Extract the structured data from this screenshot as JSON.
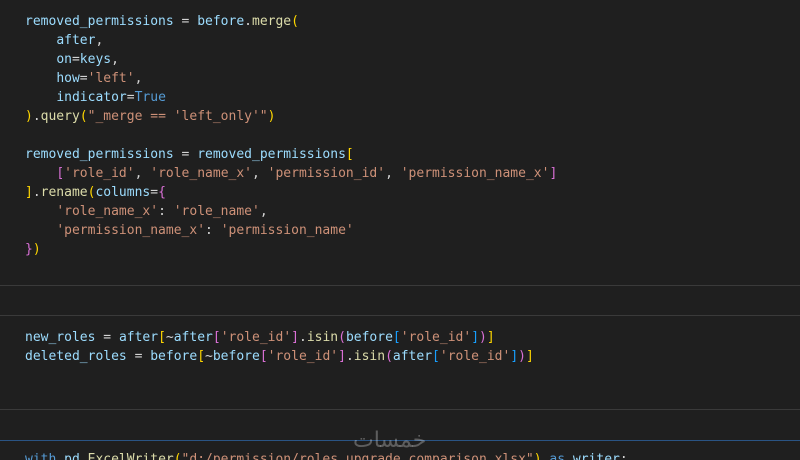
{
  "cell1": {
    "lines": [
      [
        [
          "v",
          "removed_permissions"
        ],
        [
          "o",
          " = "
        ],
        [
          "v",
          "before"
        ],
        [
          "o",
          "."
        ],
        [
          "f",
          "merge"
        ],
        [
          "b1",
          "("
        ]
      ],
      [
        [
          "o",
          "    "
        ],
        [
          "v",
          "after"
        ],
        [
          "o",
          ","
        ]
      ],
      [
        [
          "o",
          "    "
        ],
        [
          "v",
          "on"
        ],
        [
          "o",
          "="
        ],
        [
          "v",
          "keys"
        ],
        [
          "o",
          ","
        ]
      ],
      [
        [
          "o",
          "    "
        ],
        [
          "v",
          "how"
        ],
        [
          "o",
          "="
        ],
        [
          "s",
          "'left'"
        ],
        [
          "o",
          ","
        ]
      ],
      [
        [
          "o",
          "    "
        ],
        [
          "v",
          "indicator"
        ],
        [
          "o",
          "="
        ],
        [
          "k",
          "True"
        ]
      ],
      [
        [
          "b1",
          ")"
        ],
        [
          "o",
          "."
        ],
        [
          "f",
          "query"
        ],
        [
          "b1",
          "("
        ],
        [
          "s",
          "\"_merge == 'left_only'\""
        ],
        [
          "b1",
          ")"
        ]
      ],
      [
        [
          "o",
          ""
        ]
      ],
      [
        [
          "v",
          "removed_permissions"
        ],
        [
          "o",
          " = "
        ],
        [
          "v",
          "removed_permissions"
        ],
        [
          "b1",
          "["
        ]
      ],
      [
        [
          "o",
          "    "
        ],
        [
          "b2",
          "["
        ],
        [
          "s",
          "'role_id'"
        ],
        [
          "o",
          ", "
        ],
        [
          "s",
          "'role_name_x'"
        ],
        [
          "o",
          ", "
        ],
        [
          "s",
          "'permission_id'"
        ],
        [
          "o",
          ", "
        ],
        [
          "s",
          "'permission_name_x'"
        ],
        [
          "b2",
          "]"
        ]
      ],
      [
        [
          "b1",
          "]"
        ],
        [
          "o",
          "."
        ],
        [
          "f",
          "rename"
        ],
        [
          "b1",
          "("
        ],
        [
          "v",
          "columns"
        ],
        [
          "o",
          "="
        ],
        [
          "b2",
          "{"
        ]
      ],
      [
        [
          "o",
          "    "
        ],
        [
          "s",
          "'role_name_x'"
        ],
        [
          "o",
          ": "
        ],
        [
          "s",
          "'role_name'"
        ],
        [
          "o",
          ","
        ]
      ],
      [
        [
          "o",
          "    "
        ],
        [
          "s",
          "'permission_name_x'"
        ],
        [
          "o",
          ": "
        ],
        [
          "s",
          "'permission_name'"
        ]
      ],
      [
        [
          "b2",
          "}"
        ],
        [
          "b1",
          ")"
        ]
      ]
    ]
  },
  "cell2": {
    "lines": [
      [
        [
          "v",
          "new_roles"
        ],
        [
          "o",
          " = "
        ],
        [
          "v",
          "after"
        ],
        [
          "b1",
          "["
        ],
        [
          "o",
          "~"
        ],
        [
          "v",
          "after"
        ],
        [
          "b2",
          "["
        ],
        [
          "s",
          "'role_id'"
        ],
        [
          "b2",
          "]"
        ],
        [
          "o",
          "."
        ],
        [
          "f",
          "isin"
        ],
        [
          "b2",
          "("
        ],
        [
          "v",
          "before"
        ],
        [
          "b3",
          "["
        ],
        [
          "s",
          "'role_id'"
        ],
        [
          "b3",
          "]"
        ],
        [
          "b2",
          ")"
        ],
        [
          "b1",
          "]"
        ]
      ],
      [
        [
          "v",
          "deleted_roles"
        ],
        [
          "o",
          " = "
        ],
        [
          "v",
          "before"
        ],
        [
          "b1",
          "["
        ],
        [
          "o",
          "~"
        ],
        [
          "v",
          "before"
        ],
        [
          "b2",
          "["
        ],
        [
          "s",
          "'role_id'"
        ],
        [
          "b2",
          "]"
        ],
        [
          "o",
          "."
        ],
        [
          "f",
          "isin"
        ],
        [
          "b2",
          "("
        ],
        [
          "v",
          "after"
        ],
        [
          "b3",
          "["
        ],
        [
          "s",
          "'role_id'"
        ],
        [
          "b3",
          "]"
        ],
        [
          "b2",
          ")"
        ],
        [
          "b1",
          "]"
        ]
      ]
    ]
  },
  "cell3": {
    "partial_line": [
      [
        "k",
        "with"
      ],
      [
        "o",
        " "
      ],
      [
        "v",
        "pd"
      ],
      [
        "o",
        "."
      ],
      [
        "f",
        "ExcelWriter"
      ],
      [
        "b1",
        "("
      ],
      [
        "s",
        "\"d:/permission/roles_upgrade_comparison.xlsx\""
      ],
      [
        "b1",
        ")"
      ],
      [
        "o",
        " "
      ],
      [
        "k",
        "as"
      ],
      [
        "o",
        " "
      ],
      [
        "v",
        "writer"
      ],
      [
        "o",
        ":"
      ]
    ]
  },
  "watermark": {
    "text": "خمسات"
  }
}
